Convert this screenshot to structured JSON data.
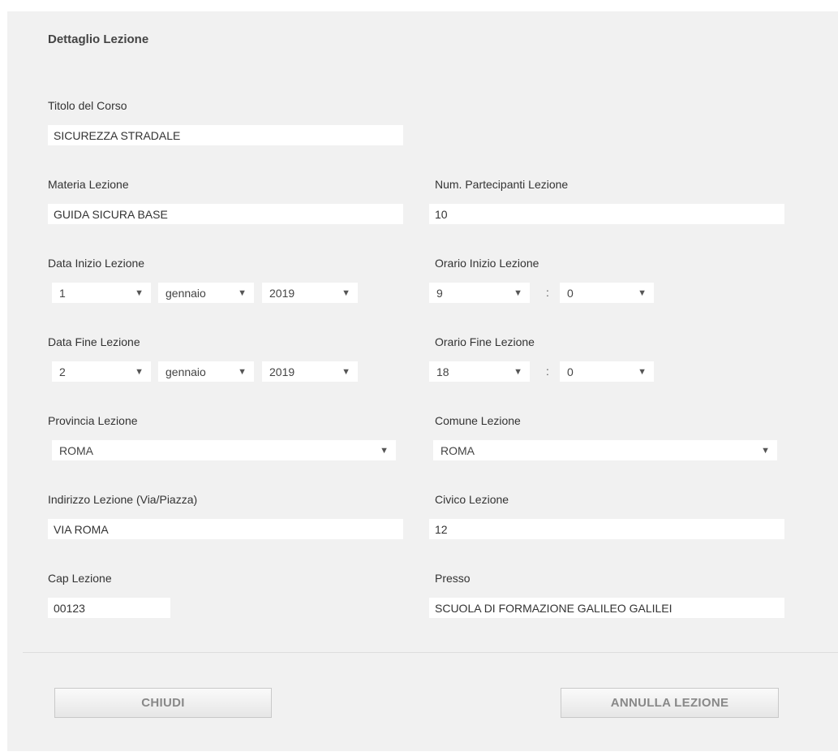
{
  "title": "Dettaglio Lezione",
  "fields": {
    "titolo_corso": {
      "label": "Titolo del Corso",
      "value": "SICUREZZA STRADALE"
    },
    "materia": {
      "label": "Materia Lezione",
      "value": "GUIDA SICURA BASE"
    },
    "partecipanti": {
      "label": "Num. Partecipanti Lezione",
      "value": "10"
    },
    "data_inizio": {
      "label": "Data Inizio Lezione",
      "day": "1",
      "month": "gennaio",
      "year": "2019"
    },
    "orario_inizio": {
      "label": "Orario Inizio Lezione",
      "hour": "9",
      "minute": "0"
    },
    "data_fine": {
      "label": "Data Fine Lezione",
      "day": "2",
      "month": "gennaio",
      "year": "2019"
    },
    "orario_fine": {
      "label": "Orario Fine Lezione",
      "hour": "18",
      "minute": "0"
    },
    "provincia": {
      "label": "Provincia Lezione",
      "value": "ROMA"
    },
    "comune": {
      "label": "Comune Lezione",
      "value": "ROMA"
    },
    "indirizzo": {
      "label": "Indirizzo Lezione (Via/Piazza)",
      "value": "VIA ROMA"
    },
    "civico": {
      "label": "Civico Lezione",
      "value": "12"
    },
    "cap": {
      "label": "Cap Lezione",
      "value": "00123"
    },
    "presso": {
      "label": "Presso",
      "value": "SCUOLA DI FORMAZIONE GALILEO GALILEI"
    }
  },
  "separator": ":",
  "dropdown_arrow": "▼",
  "icons": {
    "dropdown": "triangle-down-icon"
  },
  "buttons": {
    "close": "CHIUDI",
    "cancel_lesson": "ANNULLA LEZIONE"
  }
}
